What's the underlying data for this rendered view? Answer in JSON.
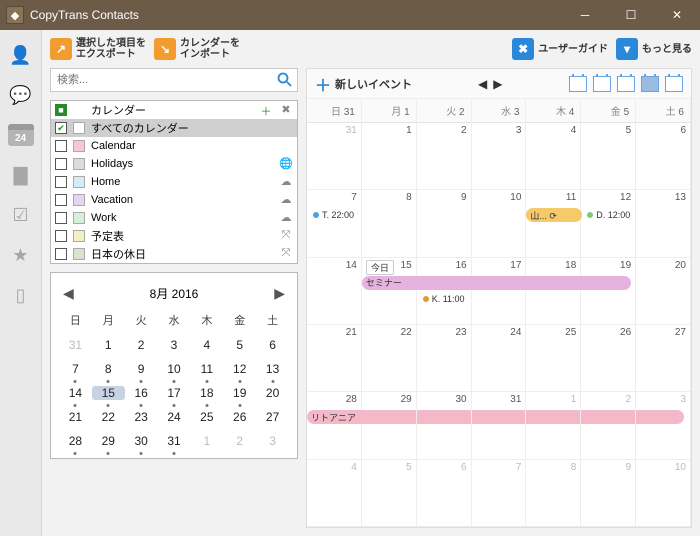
{
  "window": {
    "title": "CopyTrans Contacts"
  },
  "toolbar": {
    "export_l1": "選択した項目を",
    "export_l2": "エクスポート",
    "import_l1": "カレンダーを",
    "import_l2": "インポート",
    "user_guide": "ユーザーガイド",
    "more": "もっと見る"
  },
  "sidebar": {
    "cal_day": "24"
  },
  "search": {
    "placeholder": "検索..."
  },
  "calendars": {
    "header": "カレンダー",
    "items": [
      {
        "name": "すべてのカレンダー",
        "color": "#ffffff",
        "checked": true,
        "selected": true,
        "icon": ""
      },
      {
        "name": "Calendar",
        "color": "#f7c6d9",
        "checked": false,
        "icon": ""
      },
      {
        "name": "Holidays",
        "color": "#dcdcdc",
        "checked": false,
        "icon": "globe"
      },
      {
        "name": "Home",
        "color": "#d4ecf7",
        "checked": false,
        "icon": "cloud"
      },
      {
        "name": "Vacation",
        "color": "#e6d4f0",
        "checked": false,
        "icon": "cloud"
      },
      {
        "name": "Work",
        "color": "#d4f0d9",
        "checked": false,
        "icon": "cloud"
      },
      {
        "name": "予定表",
        "color": "#f3f0c4",
        "checked": false,
        "icon": "sync"
      },
      {
        "name": "日本の休日",
        "color": "#d8e4d0",
        "checked": false,
        "icon": "sync"
      }
    ]
  },
  "mini": {
    "title": "8月 2016",
    "dow": [
      "日",
      "月",
      "火",
      "水",
      "木",
      "金",
      "土"
    ],
    "grid": [
      [
        {
          "d": "31",
          "dim": true
        },
        {
          "d": "1"
        },
        {
          "d": "2"
        },
        {
          "d": "3"
        },
        {
          "d": "4"
        },
        {
          "d": "5"
        },
        {
          "d": "6"
        }
      ],
      [
        {
          "d": "7",
          "dot": true
        },
        {
          "d": "8",
          "dot": true
        },
        {
          "d": "9",
          "dot": true
        },
        {
          "d": "10",
          "dot": true
        },
        {
          "d": "11",
          "dot": true
        },
        {
          "d": "12",
          "dot": true
        },
        {
          "d": "13",
          "dot": true
        }
      ],
      [
        {
          "d": "14",
          "dot": true
        },
        {
          "d": "15",
          "sel": true,
          "dot": true
        },
        {
          "d": "16",
          "dot": true
        },
        {
          "d": "17",
          "dot": true
        },
        {
          "d": "18",
          "dot": true
        },
        {
          "d": "19",
          "dot": true
        },
        {
          "d": "20"
        }
      ],
      [
        {
          "d": "21"
        },
        {
          "d": "22"
        },
        {
          "d": "23"
        },
        {
          "d": "24"
        },
        {
          "d": "25"
        },
        {
          "d": "26"
        },
        {
          "d": "27"
        }
      ],
      [
        {
          "d": "28",
          "dot": true
        },
        {
          "d": "29",
          "dot": true
        },
        {
          "d": "30",
          "dot": true
        },
        {
          "d": "31",
          "dot": true
        },
        {
          "d": "1",
          "dim": true
        },
        {
          "d": "2",
          "dim": true
        },
        {
          "d": "3",
          "dim": true
        }
      ]
    ]
  },
  "big": {
    "new_event": "新しいイベント",
    "today_label": "今日",
    "head": [
      {
        "pre": "日",
        "num": "31"
      },
      {
        "pre": "月",
        "num": "1"
      },
      {
        "pre": "火",
        "num": "2"
      },
      {
        "pre": "水",
        "num": "3"
      },
      {
        "pre": "木",
        "num": "4"
      },
      {
        "pre": "金",
        "num": "5"
      },
      {
        "pre": "土",
        "num": "6"
      }
    ],
    "weeks": [
      [
        "31",
        "1",
        "2",
        "3",
        "4",
        "5",
        "6"
      ],
      [
        "7",
        "8",
        "9",
        "10",
        "11",
        "12",
        "13"
      ],
      [
        "14",
        "15",
        "16",
        "17",
        "18",
        "19",
        "20"
      ],
      [
        "21",
        "22",
        "23",
        "24",
        "25",
        "26",
        "27"
      ],
      [
        "28",
        "29",
        "30",
        "31",
        "1",
        "2",
        "3"
      ],
      [
        "4",
        "5",
        "6",
        "7",
        "8",
        "9",
        "10"
      ]
    ],
    "events": {
      "t2200": "T. 22:00",
      "yama": "山... ⟳",
      "d1200": "D. 12:00",
      "seminar": "セミナー",
      "k1100": "K. 11:00",
      "lithuania": "リトアニア"
    }
  }
}
